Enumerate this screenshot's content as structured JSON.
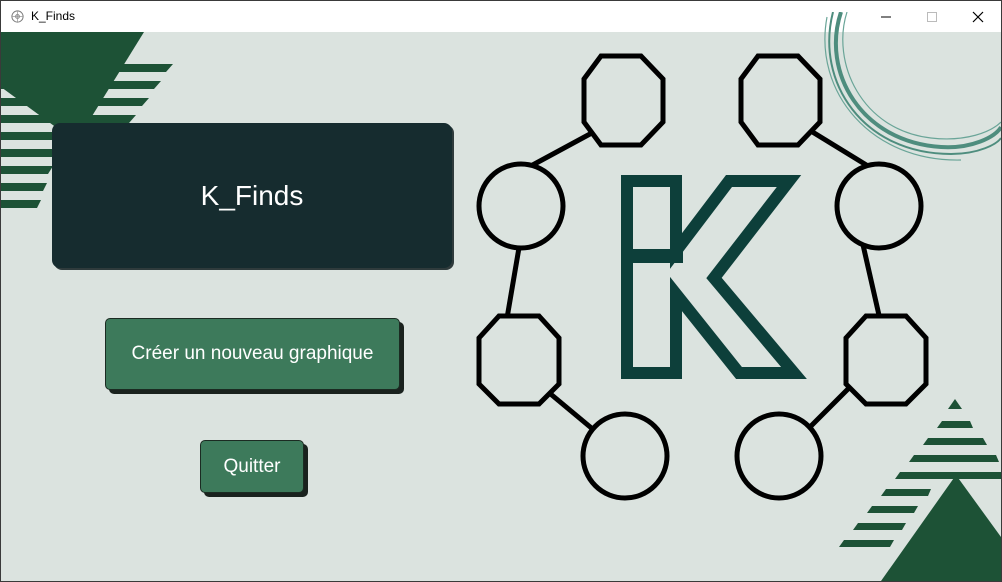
{
  "window": {
    "title": "K_Finds",
    "app_icon": "graph-network-icon",
    "controls": {
      "minimize_icon": "minimize-icon",
      "maximize_icon": "maximize-icon",
      "close_icon": "close-icon"
    }
  },
  "main": {
    "app_title": "K_Finds",
    "new_graph_button": "Créer un nouveau graphique",
    "quit_button": "Quitter"
  },
  "illustration": {
    "name": "k-graph-logo",
    "center_letter": "K"
  },
  "colors": {
    "background": "#dbe3df",
    "title_card": "#162c2f",
    "button": "#3d7a5b",
    "deco_green": "#1d5236",
    "logo_k": "#0d3f3a",
    "ring": "#4e8d7e"
  }
}
